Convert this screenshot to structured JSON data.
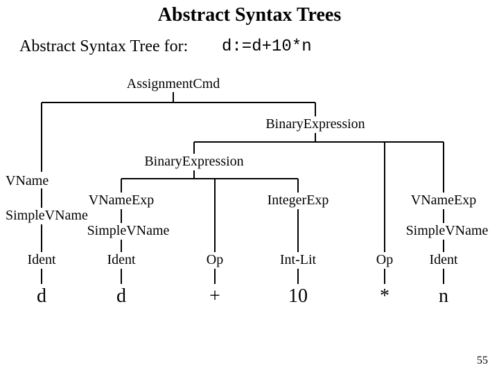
{
  "title": "Abstract Syntax Trees",
  "subtitle": "Abstract Syntax Tree for:",
  "expression": "d:=d+10*n",
  "nodes": {
    "assignmentCmd": "AssignmentCmd",
    "binaryExpr1": "BinaryExpression",
    "binaryExpr2": "BinaryExpression",
    "vname": "VName",
    "vnameExp1": "VNameExp",
    "vnameExp2": "VNameExp",
    "simpleVName1": "SimpleVName",
    "simpleVName2": "SimpleVName",
    "simpleVName3": "SimpleVName",
    "integerExp": "IntegerExp",
    "ident1": "Ident",
    "ident2": "Ident",
    "ident3": "Ident",
    "op1": "Op",
    "op2": "Op",
    "intLit": "Int-Lit"
  },
  "leaves": {
    "d1": "d",
    "d2": "d",
    "plus": "+",
    "ten": "10",
    "star": "*",
    "n": "n"
  },
  "pageNumber": "55"
}
